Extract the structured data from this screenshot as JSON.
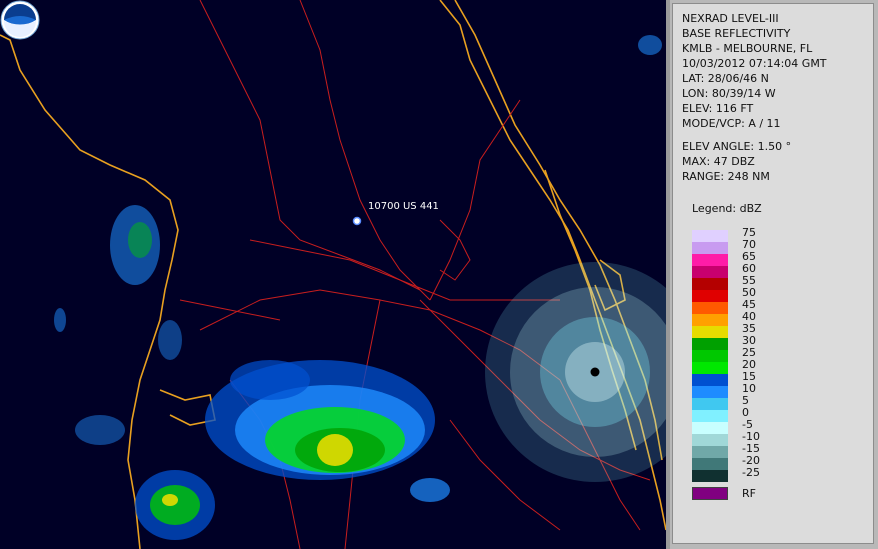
{
  "info": {
    "product": "NEXRAD LEVEL-III",
    "type": "BASE REFLECTIVITY",
    "station": "KMLB - MELBOURNE, FL",
    "datetime": "10/03/2012 07:14:04 GMT",
    "lat": "LAT: 28/06/46 N",
    "lon": "LON: 80/39/14 W",
    "elev": "ELEV: 116 FT",
    "mode": "MODE/VCP: A / 11",
    "elev_angle": "ELEV ANGLE: 1.50 °",
    "max": "MAX: 47 DBZ",
    "range": "RANGE: 248 NM"
  },
  "legend": {
    "title": "Legend: dBZ",
    "bands": [
      {
        "label": "75",
        "color": "#e0d0ff"
      },
      {
        "label": "70",
        "color": "#c89bf0"
      },
      {
        "label": "65",
        "color": "#ff1ca8"
      },
      {
        "label": "60",
        "color": "#c8006e"
      },
      {
        "label": "55",
        "color": "#b40000"
      },
      {
        "label": "50",
        "color": "#e00000"
      },
      {
        "label": "45",
        "color": "#ff5a00"
      },
      {
        "label": "40",
        "color": "#ffa000"
      },
      {
        "label": "35",
        "color": "#e6dc00"
      },
      {
        "label": "30",
        "color": "#00a000"
      },
      {
        "label": "25",
        "color": "#00c800"
      },
      {
        "label": "20",
        "color": "#00e800"
      },
      {
        "label": "15",
        "color": "#0050d0"
      },
      {
        "label": "10",
        "color": "#1e8cff"
      },
      {
        "label": "5",
        "color": "#40c8f0"
      },
      {
        "label": "0",
        "color": "#80f0ff"
      },
      {
        "label": "-5",
        "color": "#c8ffff"
      },
      {
        "label": "-10",
        "color": "#a0d8d8"
      },
      {
        "label": "-15",
        "color": "#70a8a8"
      },
      {
        "label": "-20",
        "color": "#407878"
      },
      {
        "label": "-25",
        "color": "#103030"
      }
    ],
    "rf_label": "RF",
    "rf_color": "#800080"
  },
  "map": {
    "marker_label": "10700 US 441",
    "colors": {
      "background": "#000026",
      "coastline": "#e8a020",
      "roads": "#c81e1e"
    }
  }
}
